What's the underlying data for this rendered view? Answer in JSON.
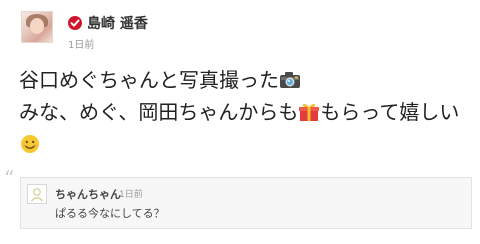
{
  "post": {
    "author": "島崎 遥香",
    "timestamp": "1日前",
    "lines": [
      "谷口めぐちゃんと写真撮った",
      "みな、めぐ、岡田ちゃんからも",
      "もらって嬉しい"
    ],
    "verified_icon": "verified-check-icon",
    "emojis": {
      "camera": "camera-icon",
      "gift": "gift-icon",
      "smile": "smile-icon"
    },
    "accent_color": "#d0152c"
  },
  "comment": {
    "quote_mark": "“",
    "author": "ちゃんちゃん",
    "timestamp": "1日前",
    "text": "ぱるる今なにしてる？",
    "avatar_icon": "default-avatar-icon"
  }
}
